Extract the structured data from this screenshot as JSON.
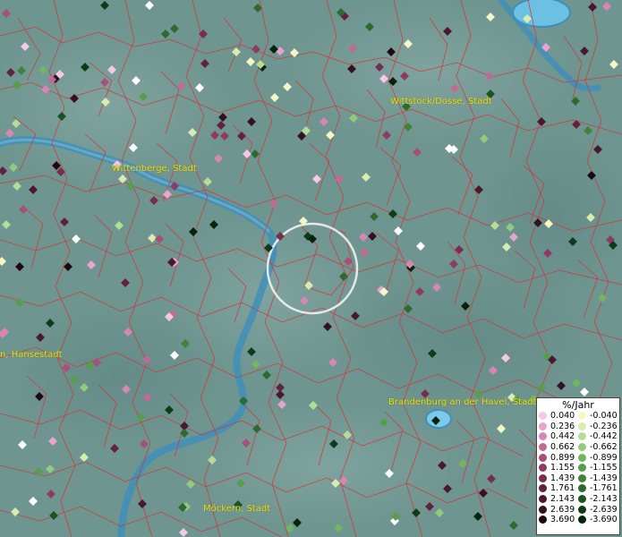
{
  "map": {
    "background_color": "#6f9591",
    "border_color": "#d33434",
    "river_color": "#3f8fb8",
    "focus_circle_color": "#f2f2f2"
  },
  "city_labels": [
    {
      "name": "Wittstock/Dosse, Stadt"
    },
    {
      "name": "Wittenberge, Stadt"
    },
    {
      "name": "n, Hansestadt"
    },
    {
      "name": "Brandenburg an der Havel, Stadt"
    },
    {
      "name": "Möckern, Stadt"
    }
  ],
  "legend": {
    "title": "%/Jahr",
    "positive": [
      {
        "label": "0.040",
        "color": "#f8c6e6"
      },
      {
        "label": "0.236",
        "color": "#eaa3cd"
      },
      {
        "label": "0.442",
        "color": "#d886b4"
      },
      {
        "label": "0.662",
        "color": "#c06b96"
      },
      {
        "label": "0.899",
        "color": "#a5517a"
      },
      {
        "label": "1.155",
        "color": "#8e3a63"
      },
      {
        "label": "1.439",
        "color": "#782c50"
      },
      {
        "label": "1.761",
        "color": "#61213f"
      },
      {
        "label": "2.143",
        "color": "#4a1730"
      },
      {
        "label": "2.639",
        "color": "#341021"
      },
      {
        "label": "3.690",
        "color": "#1f0713"
      }
    ],
    "negative": [
      {
        "label": "-0.040",
        "color": "#f3f8c6"
      },
      {
        "label": "-0.236",
        "color": "#d6edb0"
      },
      {
        "label": "-0.442",
        "color": "#b6dd96"
      },
      {
        "label": "-0.662",
        "color": "#94ca7b"
      },
      {
        "label": "-0.899",
        "color": "#74b55f"
      },
      {
        "label": "-1.155",
        "color": "#589d4a"
      },
      {
        "label": "-1.439",
        "color": "#3f843a"
      },
      {
        "label": "-1.761",
        "color": "#2c6b2d"
      },
      {
        "label": "-2.143",
        "color": "#1d5322"
      },
      {
        "label": "-2.639",
        "color": "#103b18"
      },
      {
        "label": "-3.690",
        "color": "#06230c"
      }
    ]
  }
}
